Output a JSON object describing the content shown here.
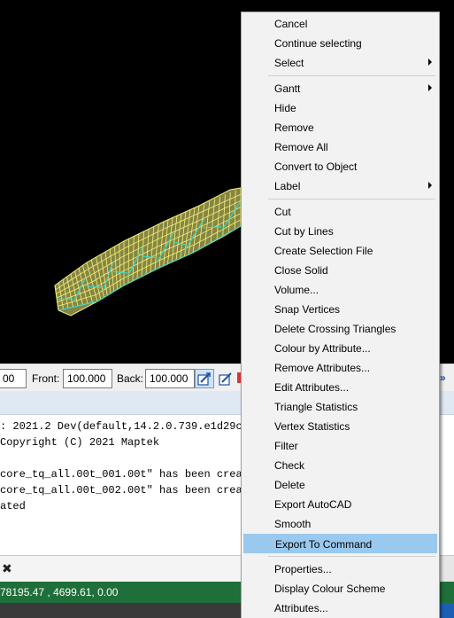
{
  "toolbar": {
    "clip_value_partial": "00",
    "front_label": "Front:",
    "front_value": "100.000",
    "back_label": "Back:",
    "back_value": "100.000",
    "overflow_arrows": "»"
  },
  "console": {
    "lines": [
      ": 2021.2 Dev(default,14.2.0.739.e1d29c2",
      "Copyright (C) 2021 Maptek",
      "",
      "core_tq_all.00t_001.00t\" has been creat",
      "core_tq_all.00t_002.00t\" has been creat",
      "ated"
    ]
  },
  "tabbar": {
    "close_glyph": "✖"
  },
  "status": {
    "coords": "78195.47 , 4699.61, 0.00"
  },
  "context_menu": {
    "groups": [
      [
        {
          "label": "Cancel",
          "submenu": false
        },
        {
          "label": "Continue selecting",
          "submenu": false
        },
        {
          "label": "Select",
          "submenu": true
        }
      ],
      [
        {
          "label": "Gantt",
          "submenu": true
        },
        {
          "label": "Hide",
          "submenu": false
        },
        {
          "label": "Remove",
          "submenu": false
        },
        {
          "label": "Remove All",
          "submenu": false
        },
        {
          "label": "Convert to Object",
          "submenu": false
        },
        {
          "label": "Label",
          "submenu": true
        }
      ],
      [
        {
          "label": "Cut",
          "submenu": false
        },
        {
          "label": "Cut by Lines",
          "submenu": false
        },
        {
          "label": "Create Selection File",
          "submenu": false
        },
        {
          "label": "Close Solid",
          "submenu": false
        },
        {
          "label": "Volume...",
          "submenu": false
        },
        {
          "label": "Snap Vertices",
          "submenu": false
        },
        {
          "label": "Delete Crossing Triangles",
          "submenu": false
        },
        {
          "label": "Colour by Attribute...",
          "submenu": false
        },
        {
          "label": "Remove Attributes...",
          "submenu": false
        },
        {
          "label": "Edit Attributes...",
          "submenu": false
        },
        {
          "label": "Triangle Statistics",
          "submenu": false
        },
        {
          "label": "Vertex Statistics",
          "submenu": false
        },
        {
          "label": "Filter",
          "submenu": false
        },
        {
          "label": "Check",
          "submenu": false
        },
        {
          "label": "Delete",
          "submenu": false
        },
        {
          "label": "Export AutoCAD",
          "submenu": false
        },
        {
          "label": "Smooth",
          "submenu": false
        },
        {
          "label": "Export To Command",
          "submenu": false,
          "highlighted": true
        }
      ],
      [
        {
          "label": "Properties...",
          "submenu": false
        },
        {
          "label": "Display Colour Scheme",
          "submenu": false
        },
        {
          "label": "Attributes...",
          "submenu": false
        }
      ]
    ]
  },
  "colors": {
    "solid_wire": "#f4f27a",
    "solid_edge": "#3fd6c8",
    "highlight": "#99c9ef",
    "status_bg": "#1f6f3a"
  }
}
